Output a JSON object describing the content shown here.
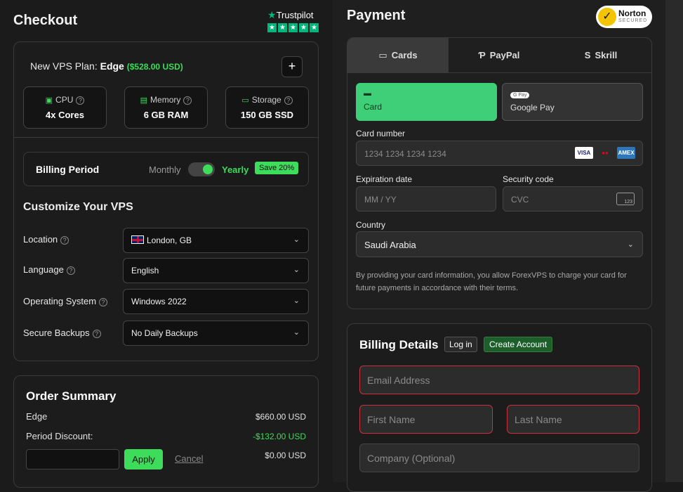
{
  "checkout": {
    "title": "Checkout",
    "trustpilot": "Trustpilot",
    "plan": {
      "prefix": "New VPS Plan: ",
      "name": "Edge",
      "price": "($528.00 USD)",
      "add_label": "+"
    },
    "specs": [
      {
        "label": "CPU",
        "value": "4x Cores",
        "icon": "cpu-icon"
      },
      {
        "label": "Memory",
        "value": "6 GB RAM",
        "icon": "memory-icon"
      },
      {
        "label": "Storage",
        "value": "150 GB SSD",
        "icon": "storage-icon"
      }
    ],
    "billing": {
      "title": "Billing Period",
      "monthly": "Monthly",
      "yearly": "Yearly",
      "badge": "Save 20%"
    },
    "customize": {
      "title": "Customize Your VPS",
      "rows": [
        {
          "label": "Location",
          "value": "London, GB"
        },
        {
          "label": "Language",
          "value": "English"
        },
        {
          "label": "Operating System",
          "value": "Windows 2022"
        },
        {
          "label": "Secure Backups",
          "value": "No Daily Backups"
        }
      ]
    },
    "order": {
      "title": "Order Summary",
      "line_label": "Edge",
      "line_value": "$660.00 USD",
      "discount_label": "Period Discount:",
      "discount_value": "-$132.00 USD",
      "coupon_value": "$0.00 USD",
      "apply": "Apply",
      "cancel": "Cancel"
    }
  },
  "payment": {
    "title": "Payment",
    "norton_title": "Norton",
    "norton_sub": "SECURED",
    "tabs": [
      {
        "label": "Cards",
        "icon": "card-icon"
      },
      {
        "label": "PayPal",
        "icon": "paypal-icon"
      },
      {
        "label": "Skrill",
        "icon": "skrill-icon"
      }
    ],
    "methods": [
      {
        "label": "Card"
      },
      {
        "label": "Google Pay",
        "pill": "G Pay"
      }
    ],
    "card_number_label": "Card number",
    "card_number_placeholder": "1234 1234 1234 1234",
    "expiration_label": "Expiration date",
    "expiration_placeholder": "MM / YY",
    "security_label": "Security code",
    "security_placeholder": "CVC",
    "cvc_icon_text": "123",
    "country_label": "Country",
    "country_value": "Saudi Arabia",
    "disclaimer": "By providing your card information, you allow ForexVPS to charge your card for future payments in accordance with their terms.",
    "card_brands": [
      "VISA",
      "",
      "AMEX"
    ]
  },
  "billing_details": {
    "title": "Billing Details",
    "login": "Log in",
    "create": "Create Account",
    "email": "Email Address",
    "first": "First Name",
    "last": "Last Name",
    "company": "Company (Optional)"
  },
  "colors": {
    "accent": "#3ddc5a",
    "error": "#c8323c",
    "trustpilot": "#00b67a"
  }
}
